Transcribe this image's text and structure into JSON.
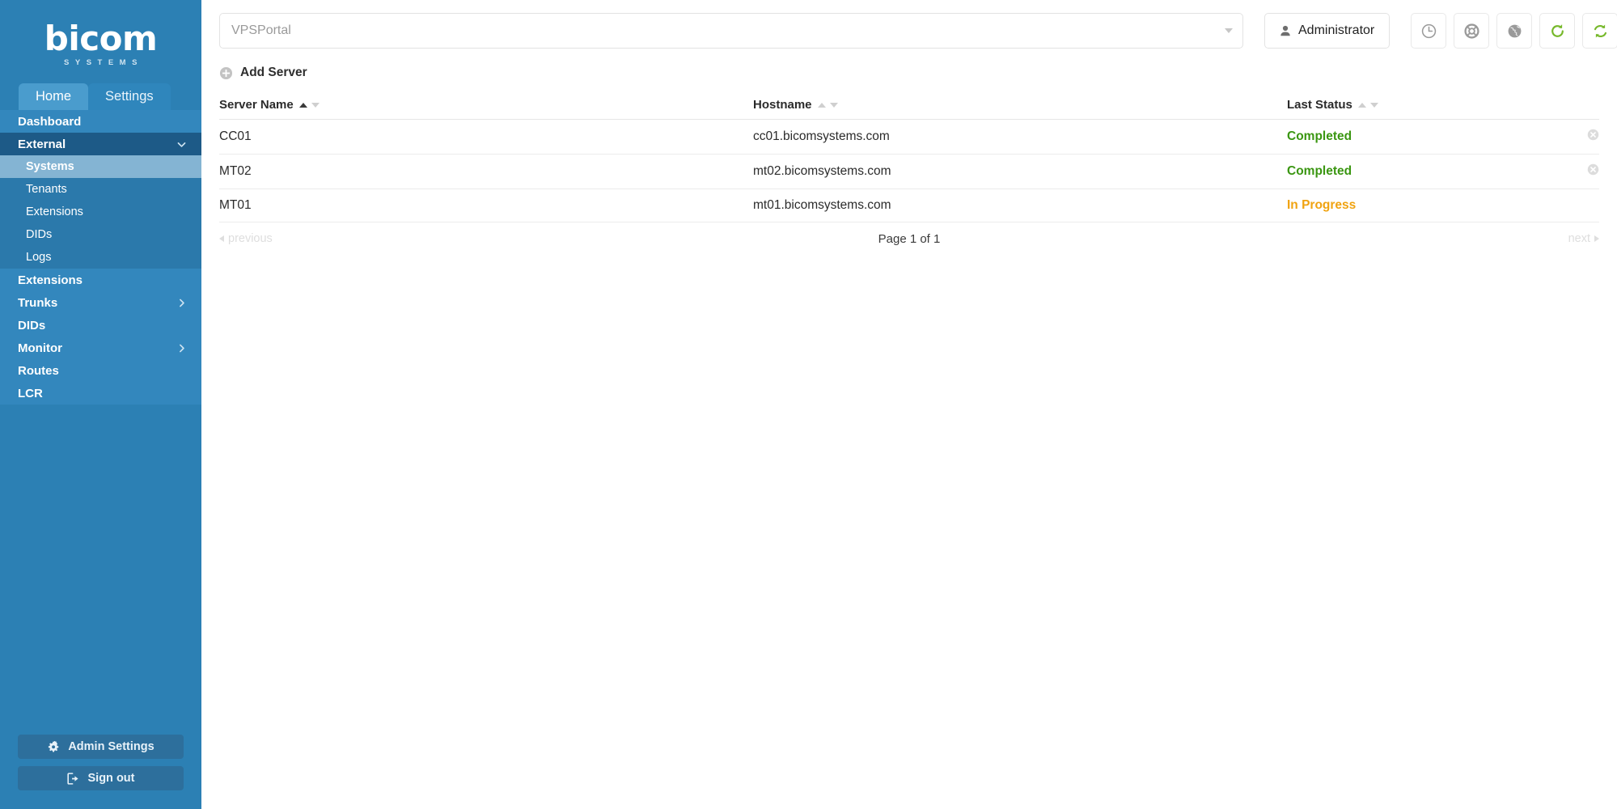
{
  "brand": {
    "name": "bicom",
    "tagline": "SYSTEMS"
  },
  "sidebar": {
    "tabs": [
      {
        "label": "Home",
        "active": true
      },
      {
        "label": "Settings",
        "active": false
      }
    ],
    "nav": [
      {
        "label": "Dashboard"
      },
      {
        "label": "External"
      },
      {
        "label": "Extensions"
      },
      {
        "label": "Trunks"
      },
      {
        "label": "DIDs"
      },
      {
        "label": "Monitor"
      },
      {
        "label": "Routes"
      },
      {
        "label": "LCR"
      }
    ],
    "external_children": [
      {
        "label": "Systems",
        "selected": true
      },
      {
        "label": "Tenants",
        "selected": false
      },
      {
        "label": "Extensions",
        "selected": false
      },
      {
        "label": "DIDs",
        "selected": false
      },
      {
        "label": "Logs",
        "selected": false
      }
    ],
    "admin_settings_label": "Admin Settings",
    "sign_out_label": "Sign out"
  },
  "topbar": {
    "server_select_value": "VPSPortal",
    "admin_label": "Administrator",
    "icons": [
      {
        "name": "clock-icon"
      },
      {
        "name": "life-ring-icon"
      },
      {
        "name": "globe-icon"
      },
      {
        "name": "refresh-icon"
      },
      {
        "name": "sync-icon"
      }
    ]
  },
  "toolbar": {
    "add_server_label": "Add Server"
  },
  "table": {
    "columns": [
      {
        "label": "Server Name",
        "sort": "asc"
      },
      {
        "label": "Hostname",
        "sort": "none"
      },
      {
        "label": "Last Status",
        "sort": "none"
      },
      {
        "label": ""
      }
    ],
    "rows": [
      {
        "server_name": "CC01",
        "hostname": "cc01.bicomsystems.com",
        "status": "Completed",
        "status_color": "#3a9611",
        "deletable": true
      },
      {
        "server_name": "MT02",
        "hostname": "mt02.bicomsystems.com",
        "status": "Completed",
        "status_color": "#3a9611",
        "deletable": true
      },
      {
        "server_name": "MT01",
        "hostname": "mt01.bicomsystems.com",
        "status": "In Progress",
        "status_color": "#f0a311",
        "deletable": false
      }
    ]
  },
  "pagination": {
    "previous_label": "previous",
    "page_label": "Page 1 of 1",
    "next_label": "next"
  },
  "colors": {
    "sidebar_bg": "#2c80b4",
    "sidebar_expanded": "#1d5a87",
    "sidebar_selected": "#84b4d3",
    "accent_green": "#76b82a",
    "status_completed": "#3a9611",
    "status_in_progress": "#f0a311"
  }
}
